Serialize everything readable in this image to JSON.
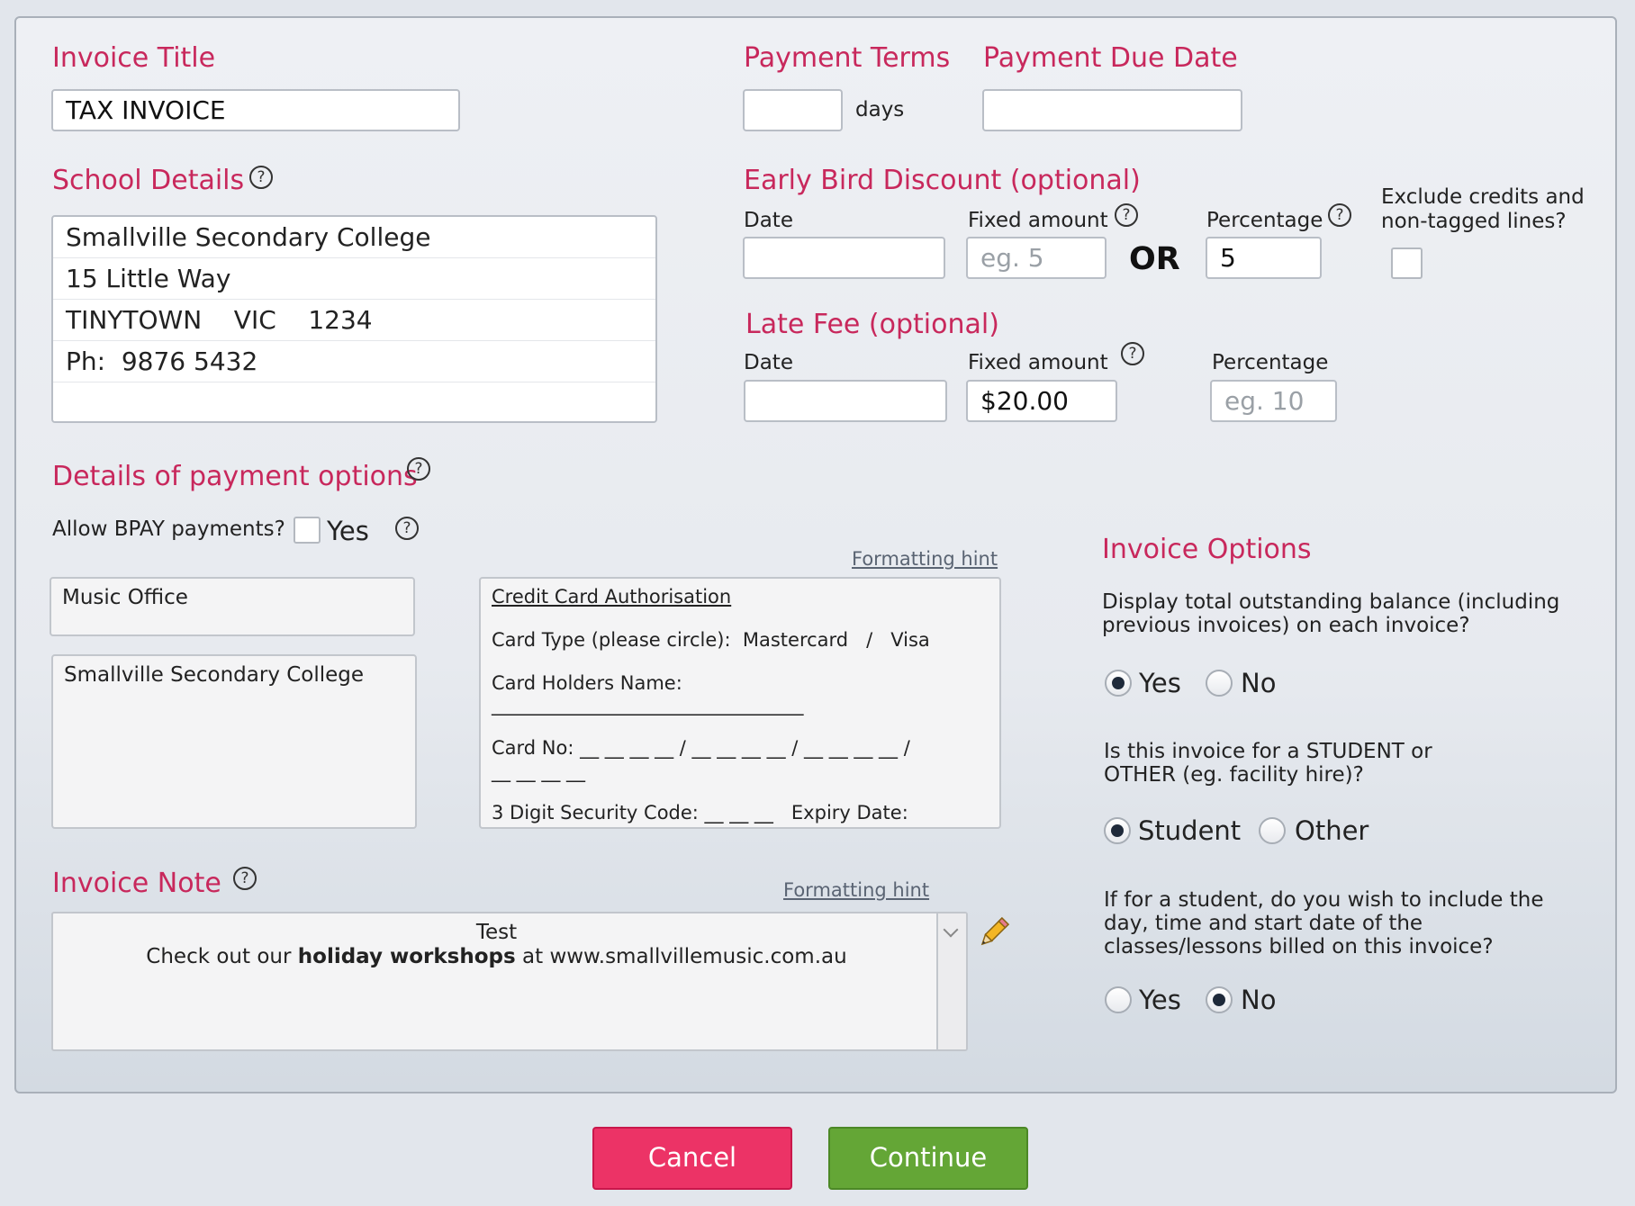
{
  "invoice_title": {
    "heading": "Invoice Title",
    "value": "TAX INVOICE"
  },
  "payment_terms": {
    "heading": "Payment Terms",
    "value": "",
    "unit": "days"
  },
  "payment_due_date": {
    "heading": "Payment Due Date",
    "value": ""
  },
  "school_details": {
    "heading": "School Details",
    "help_icon": "?",
    "lines": [
      "Smallville Secondary College",
      "15 Little Way",
      "TINYTOWN    VIC    1234",
      "Ph:  9876 5432",
      ""
    ]
  },
  "early_bird": {
    "heading": "Early Bird Discount (optional)",
    "date_label": "Date",
    "date_value": "",
    "fixed_label": "Fixed amount",
    "fixed_placeholder": "eg. 5",
    "or_label": "OR",
    "percentage_label": "Percentage",
    "percentage_value": "5",
    "exclude_label_1": "Exclude credits and",
    "exclude_label_2": "non-tagged lines?"
  },
  "late_fee": {
    "heading": "Late Fee (optional)",
    "date_label": "Date",
    "date_value": "",
    "fixed_label": "Fixed amount",
    "fixed_value": "$20.00",
    "percentage_label": "Percentage",
    "percentage_placeholder": "eg. 10"
  },
  "payment_options": {
    "heading": "Details of payment options",
    "bpay_label": "Allow BPAY payments?",
    "bpay_yes": "Yes",
    "box1": "Music Office",
    "box2": "Smallville Secondary College",
    "formatting_hint": "Formatting hint",
    "cc": {
      "title": "Credit Card Authorisation",
      "card_type": "Card Type (please circle):  Mastercard   /   Visa",
      "holder": "Card Holders Name:",
      "holder_line": "_________________________________",
      "card_no_1": "Card No: __ __ __ __ / __ __ __ __ / __ __ __ __ /",
      "card_no_2": "__ __ __ __",
      "security": "3 Digit Security Code: __ __ __   Expiry Date:"
    }
  },
  "invoice_note": {
    "heading": "Invoice Note",
    "formatting_hint": "Formatting hint",
    "line1": "Test",
    "line2_pre": "Check out our ",
    "line2_bold": "holiday workshops",
    "line2_post": " at www.smallvillemusic.com.au"
  },
  "invoice_options": {
    "heading": "Invoice Options",
    "q1_a": "Display total outstanding balance (including",
    "q1_b": "previous invoices) on each invoice?",
    "q1_yes": "Yes",
    "q1_no": "No",
    "q2_a": "Is this invoice for a STUDENT or",
    "q2_b": "OTHER (eg. facility hire)?",
    "q2_student": "Student",
    "q2_other": "Other",
    "q3_a": "If for a student, do you wish to include the",
    "q3_b": "day, time and start date of the",
    "q3_c": "classes/lessons billed on this invoice?",
    "q3_yes": "Yes",
    "q3_no": "No"
  },
  "buttons": {
    "cancel": "Cancel",
    "continue": "Continue"
  }
}
